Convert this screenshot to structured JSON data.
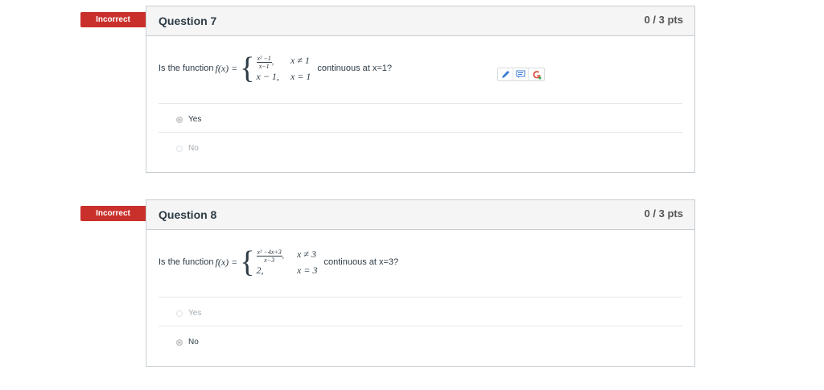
{
  "questions": [
    {
      "status": "Incorrect",
      "title": "Question 7",
      "points": "0 / 3 pts",
      "prompt_prefix": "Is the function ",
      "fx": "f(x) =",
      "case1_num": "x² −1",
      "case1_den": "x−1",
      "case1_cond": "x ≠ 1",
      "case2_expr": "x − 1,",
      "case2_cond": "x = 1",
      "prompt_suffix": "continuous at x=1?",
      "answers": [
        {
          "label": "Yes",
          "selected": true
        },
        {
          "label": "No",
          "selected": false
        }
      ]
    },
    {
      "status": "Incorrect",
      "title": "Question 8",
      "points": "0 / 3 pts",
      "prompt_prefix": "Is the function ",
      "fx": "f(x) =",
      "case1_num": "x² −4x+3",
      "case1_den": "x−3",
      "case1_cond": "x ≠ 3",
      "case2_expr": "2,",
      "case2_cond": "x = 3",
      "prompt_suffix": "continuous at x=3?",
      "answers": [
        {
          "label": "Yes",
          "selected": false
        },
        {
          "label": "No",
          "selected": true
        }
      ]
    }
  ],
  "tools": [
    "pencil-icon",
    "comment-icon",
    "google-icon"
  ],
  "colors": {
    "badge": "#c9302c",
    "border": "#c7cdd1",
    "header_bg": "#f5f5f5"
  }
}
